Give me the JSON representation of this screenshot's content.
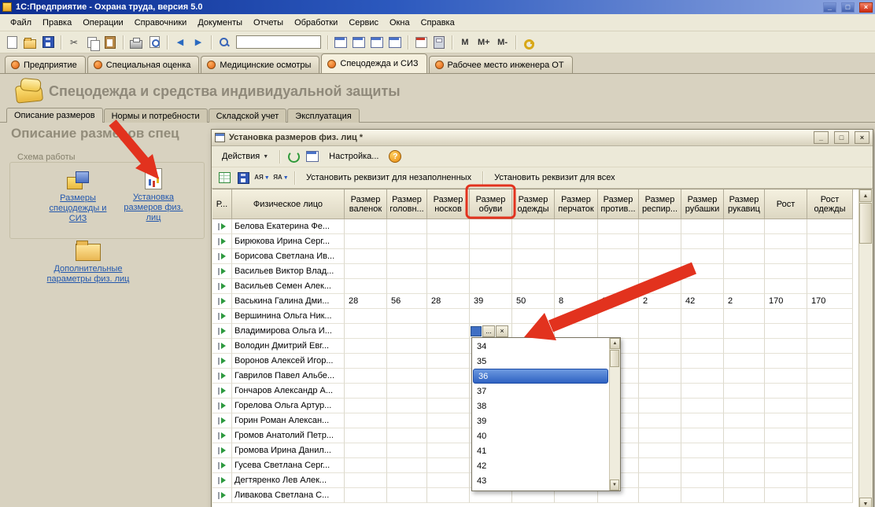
{
  "window": {
    "title": "1С:Предприятие - Охрана труда, версия 5.0"
  },
  "glyphs": {
    "min": "_",
    "max": "□",
    "close": "×",
    "dropdown": "▼",
    "up": "▲",
    "down": "▼",
    "question": "?",
    "cut": "✂",
    "undo": "◀",
    "redo": "▶",
    "sort_az": "АЯ",
    "sort_za": "ЯА"
  },
  "colors": {
    "accent_red": "#e2321e",
    "selection_blue": "#2f62c2",
    "link_blue": "#2257ad"
  },
  "menu": {
    "items": [
      "Файл",
      "Правка",
      "Операции",
      "Справочники",
      "Документы",
      "Отчеты",
      "Обработки",
      "Сервис",
      "Окна",
      "Справка"
    ]
  },
  "toolbar": {
    "search_value": "",
    "memory_buttons": [
      "M",
      "M+",
      "M-"
    ]
  },
  "desktop_tabs": [
    {
      "label": "Предприятие",
      "active": false
    },
    {
      "label": "Специальная оценка",
      "active": false
    },
    {
      "label": "Медицинские осмотры",
      "active": false
    },
    {
      "label": "Спецодежда и СИЗ",
      "active": true
    },
    {
      "label": "Рабочее место инженера ОТ",
      "active": false
    }
  ],
  "page": {
    "title": "Спецодежда и средства индивидуальной защиты",
    "subtabs": [
      {
        "label": "Описание размеров",
        "active": true
      },
      {
        "label": "Нормы и потребности",
        "active": false
      },
      {
        "label": "Складской учет",
        "active": false
      },
      {
        "label": "Эксплуатация",
        "active": false
      }
    ],
    "sidebar": {
      "heading": "Описание размеров спец",
      "group_label": "Схема работы",
      "links": [
        {
          "label": "Размеры спецодежды и СИЗ"
        },
        {
          "label": "Установка размеров физ. лиц"
        },
        {
          "label": "Дополнительные параметры физ. лиц"
        }
      ]
    }
  },
  "dialog": {
    "title": "Установка размеров физ. лиц *",
    "toolbar": {
      "actions_label": "Действия",
      "settings_label": "Настройка...",
      "set_empty_label": "Установить реквизит для незаполненных",
      "set_all_label": "Установить реквизит для всех"
    },
    "editor": {
      "more_label": "...",
      "clear_label": "×"
    },
    "table": {
      "columns": [
        "Р...",
        "Физическое лицо",
        "Размер валенок",
        "Размер головн...",
        "Размер носков",
        "Размер обуви",
        "Размер одежды",
        "Размер перчаток",
        "Размер против...",
        "Размер респир...",
        "Размер рубашки",
        "Размер рукавиц",
        "Рост",
        "Рост одежды"
      ],
      "rows": [
        {
          "name": "Белова Екатерина Фе..."
        },
        {
          "name": "Бирюкова Ирина Серг..."
        },
        {
          "name": "Борисова Светлана Ив..."
        },
        {
          "name": "Васильев Виктор Влад..."
        },
        {
          "name": "Васильев Семен Алек..."
        },
        {
          "name": "Васькина Галина Дми...",
          "values": [
            "28",
            "56",
            "28",
            "39",
            "50",
            "8",
            "2",
            "2",
            "42",
            "2",
            "170",
            "170"
          ]
        },
        {
          "name": "Вершинина Ольга Ник..."
        },
        {
          "name": "Владимирова Ольга И...",
          "editor": true
        },
        {
          "name": "Володин Дмитрий Евг..."
        },
        {
          "name": "Воронов Алексей Игор..."
        },
        {
          "name": "Гаврилов Павел Альбе..."
        },
        {
          "name": "Гончаров Александр А..."
        },
        {
          "name": "Горелова Ольга Артур..."
        },
        {
          "name": "Горин Роман Алексан..."
        },
        {
          "name": "Громов Анатолий Петр..."
        },
        {
          "name": "Громова Ирина Данил..."
        },
        {
          "name": "Гусева Светлана Серг..."
        },
        {
          "name": "Дегтяренко Лев Алек..."
        },
        {
          "name": "Ливакова Светлана С..."
        }
      ]
    },
    "dropdown": {
      "items": [
        "34",
        "35",
        "36",
        "37",
        "38",
        "39",
        "40",
        "41",
        "42",
        "43"
      ],
      "selected": "36"
    }
  }
}
